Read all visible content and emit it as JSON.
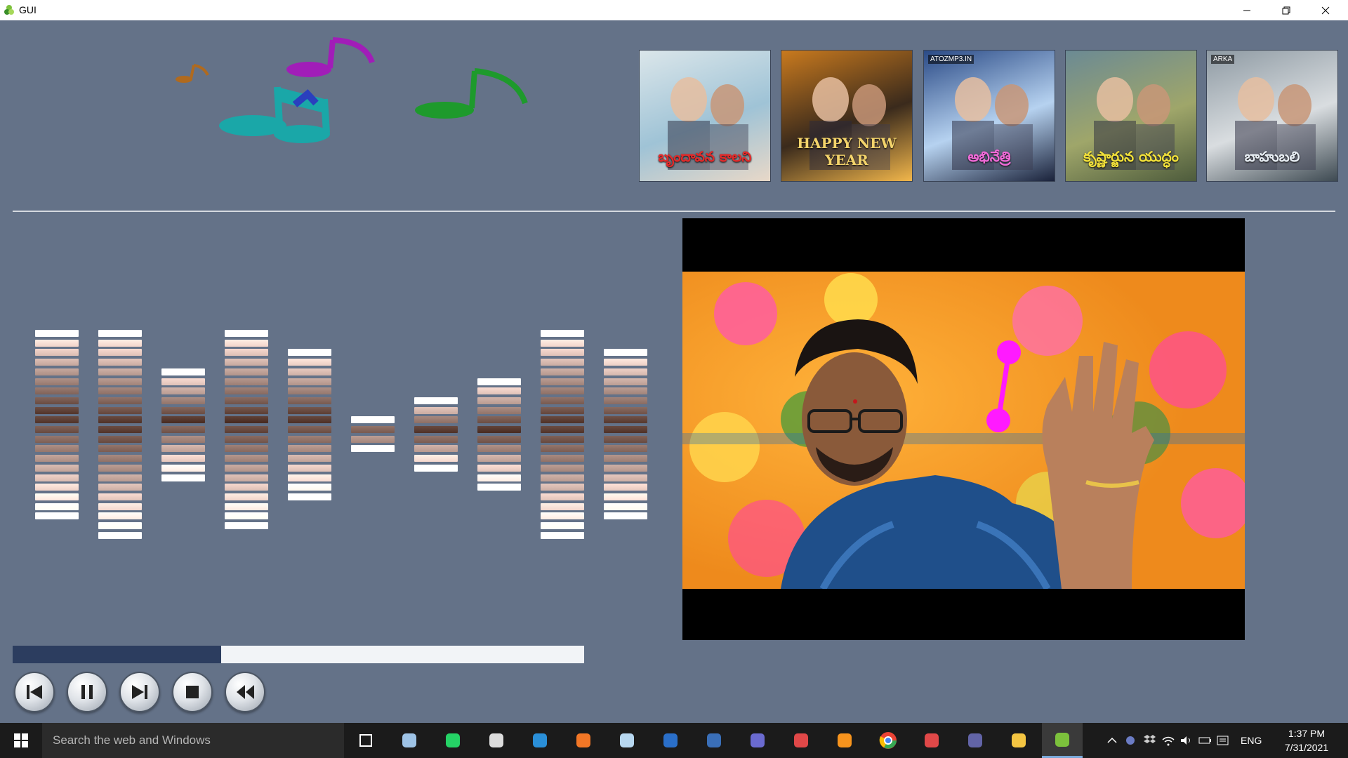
{
  "window": {
    "title": "GUI"
  },
  "posters": [
    {
      "caption": "బృందావన కాలని",
      "caption_color": "#e32a2a",
      "tag": "",
      "palette": [
        "#dbe6ea",
        "#9fc3d6",
        "#e8d8c8"
      ]
    },
    {
      "caption": "HAPPY NEW YEAR",
      "caption_color": "#f3d36b",
      "tag": "",
      "palette": [
        "#c97a1e",
        "#3a2a1c",
        "#f1b64b"
      ]
    },
    {
      "caption": "అభినేత్రి",
      "caption_color": "#f06bd8",
      "tag": "ATOZMP3.IN",
      "palette": [
        "#2a4a86",
        "#b6d2f0",
        "#1a223a"
      ]
    },
    {
      "caption": "కృష్ణార్జున యుద్ధం",
      "caption_color": "#f2e13a",
      "tag": "",
      "palette": [
        "#6b8a94",
        "#9fa66a",
        "#4d5b3c"
      ]
    },
    {
      "caption": "బాహుబలి",
      "caption_color": "#e6ecf2",
      "tag": "ARKA",
      "palette": [
        "#8e9aa3",
        "#d9dde0",
        "#3e4a52"
      ]
    }
  ],
  "equalizer": [
    {
      "segments": 20,
      "top_band": 0
    },
    {
      "segments": 22,
      "top_band": 0
    },
    {
      "segments": 12,
      "top_band": 4
    },
    {
      "segments": 21,
      "top_band": 0
    },
    {
      "segments": 16,
      "top_band": 2
    },
    {
      "segments": 4,
      "top_band": 9
    },
    {
      "segments": 8,
      "top_band": 7
    },
    {
      "segments": 12,
      "top_band": 5
    },
    {
      "segments": 22,
      "top_band": 0
    },
    {
      "segments": 18,
      "top_band": 2
    }
  ],
  "progress": {
    "value": 0.365
  },
  "controls": [
    {
      "name": "previous-button",
      "icon": "skip-back-icon"
    },
    {
      "name": "pause-button",
      "icon": "pause-icon"
    },
    {
      "name": "next-button",
      "icon": "skip-forward-icon"
    },
    {
      "name": "stop-button",
      "icon": "stop-icon"
    },
    {
      "name": "rewind-button",
      "icon": "rewind-icon"
    }
  ],
  "taskbar": {
    "search_placeholder": "Search the web and Windows",
    "language": "ENG",
    "time": "1:37 PM",
    "date": "7/31/2021",
    "apps": [
      "task-view-icon",
      "browser-icon",
      "whatsapp-icon",
      "obs-icon",
      "vscode-icon",
      "jupyter-icon",
      "snipping-icon",
      "r-icon",
      "devcpp-icon",
      "app-icon",
      "spider-icon",
      "sublime-icon",
      "chrome-icon",
      "spider-icon",
      "teams-icon",
      "file-explorer-icon",
      "python-gui-icon"
    ]
  },
  "colors": {
    "background": "#647288",
    "progress_fill": "#2c3d5f",
    "progress_track": "#f2f4f7",
    "hand_marker": "#ff1aff"
  }
}
